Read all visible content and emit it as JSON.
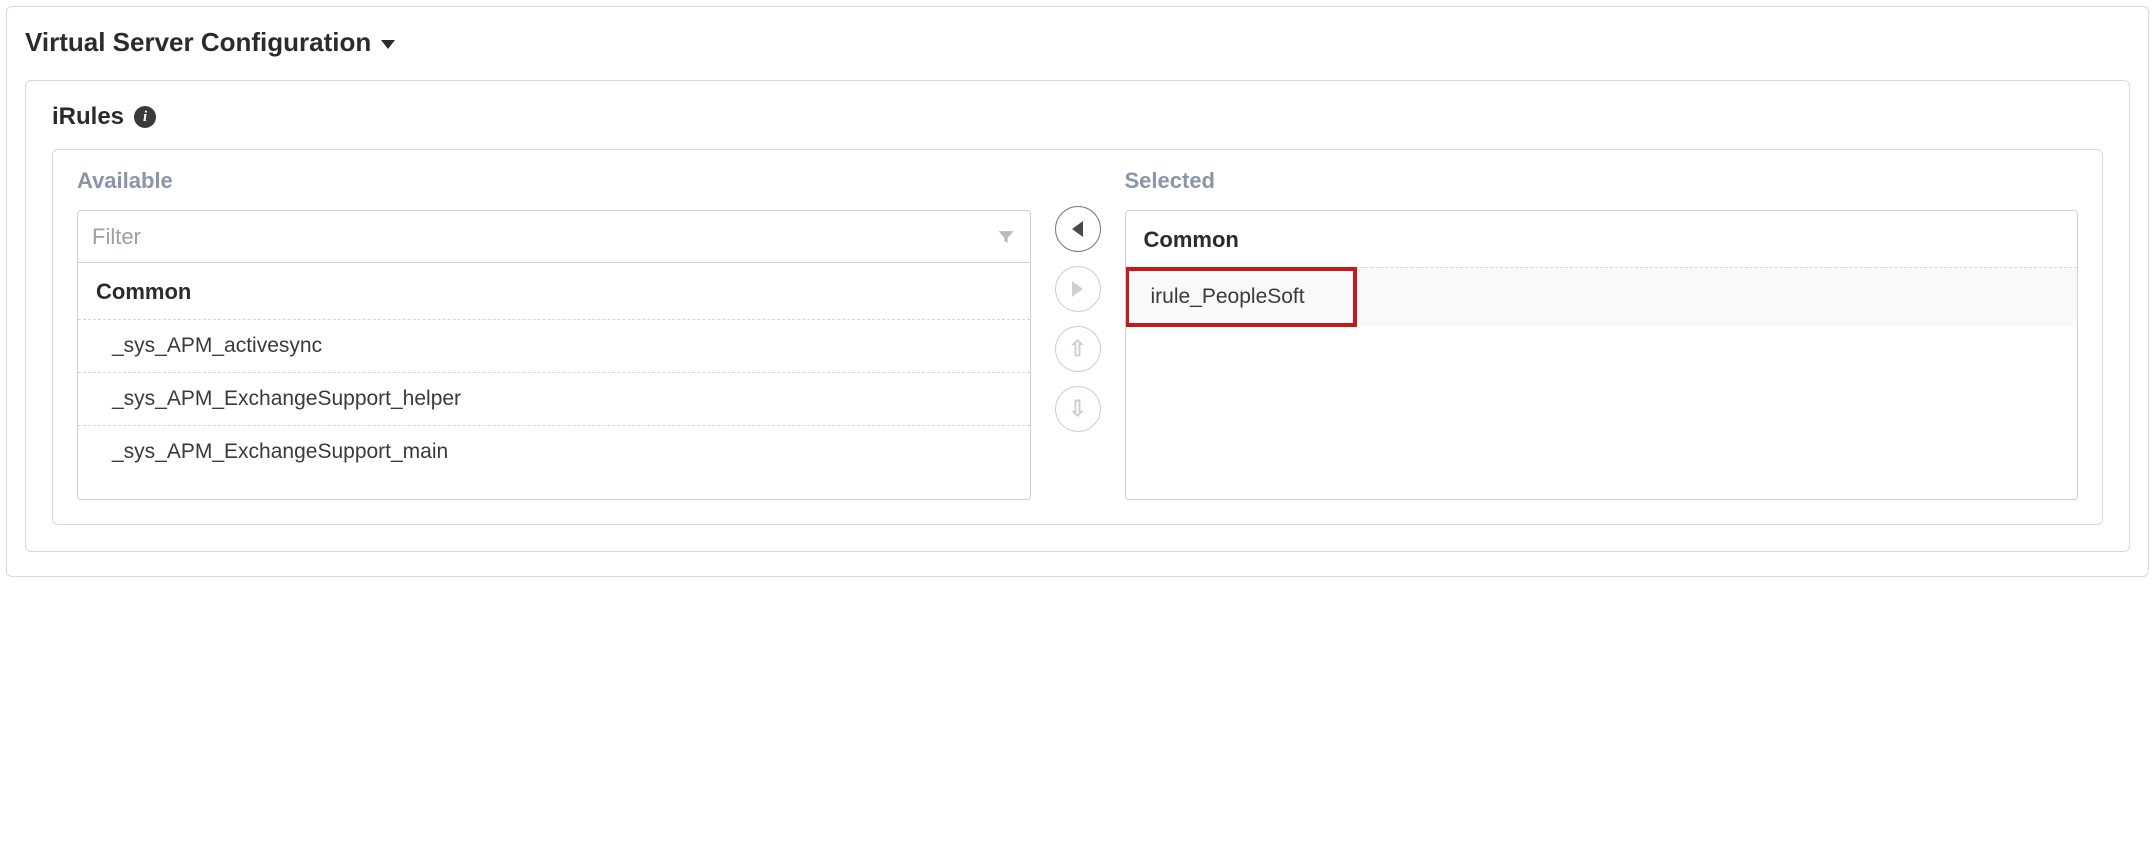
{
  "section": {
    "title": "Virtual Server Configuration"
  },
  "subsection": {
    "title": "iRules"
  },
  "filter": {
    "placeholder": "Filter"
  },
  "available": {
    "label": "Available",
    "group": "Common",
    "items": [
      "_sys_APM_activesync",
      "_sys_APM_ExchangeSupport_helper",
      "_sys_APM_ExchangeSupport_main"
    ]
  },
  "selected": {
    "label": "Selected",
    "group": "Common",
    "items": [
      "irule_PeopleSoft"
    ]
  }
}
